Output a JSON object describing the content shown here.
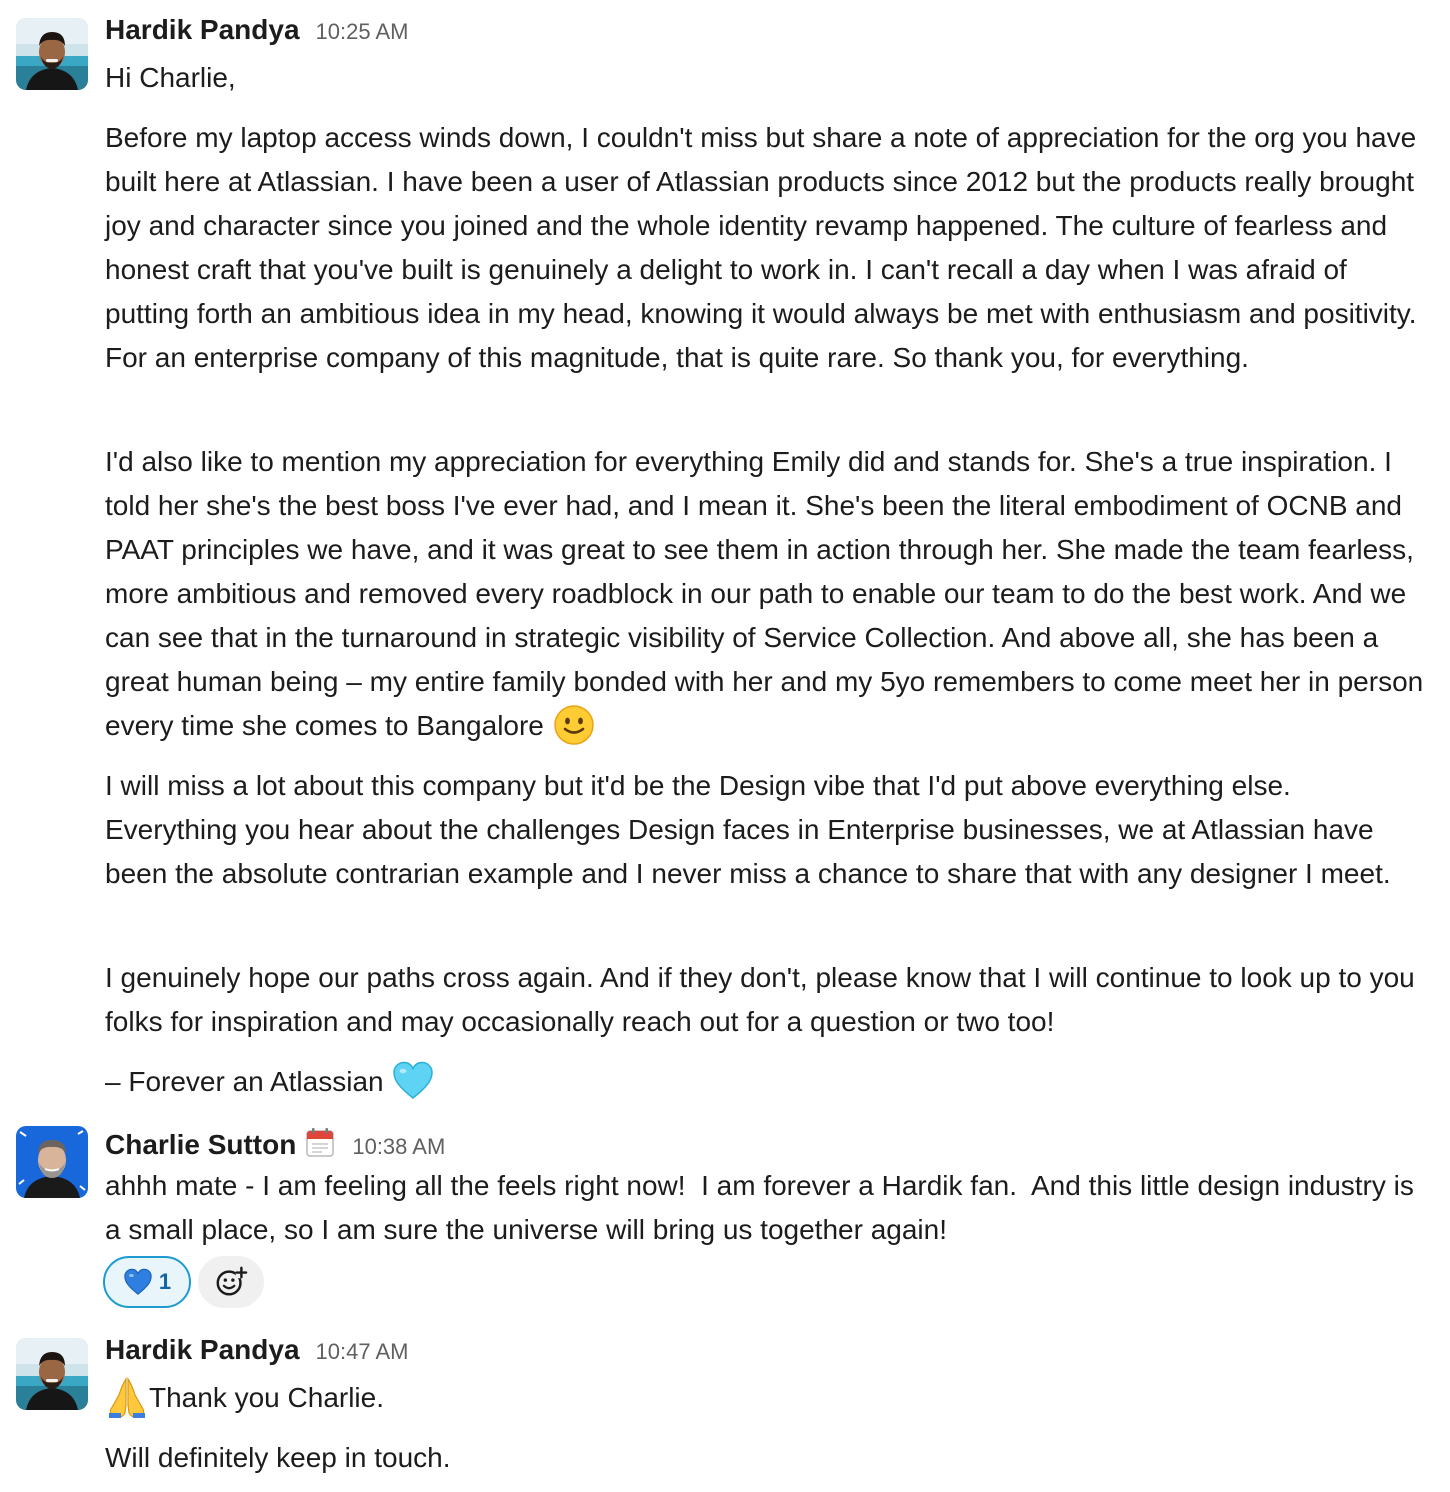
{
  "messages": [
    {
      "sender": "Hardik Pandya",
      "time": "10:25 AM",
      "paragraphs": [
        "Hi Charlie,",
        "Before my laptop access winds down, I couldn't miss but share a note of appreciation for the org you have built here at Atlassian. I have been a user of Atlassian products since 2012 but the products really brought joy and character since you joined and the whole identity revamp happened. The culture of fearless and honest craft that you've built is genuinely a delight to work in. I can't recall a day when I was afraid of putting forth an ambitious idea in my head, knowing it would always be met with enthusiasm and positivity. For an enterprise company of this magnitude, that is quite rare. So thank you, for everything.",
        "I'd also like to mention my appreciation for everything Emily did and stands for. She's a true inspiration. I told her she's the best boss I've ever had, and I mean it. She's been the literal embodiment of OCNB and PAAT principles we have, and it was great to see them in action through her. She made the team fearless, more ambitious and removed every roadblock in our path to enable our team to do the best work. And we can see that in the turnaround in strategic visibility of Service Collection. And above all, she has been a great human being – my entire family bonded with her and my 5yo remembers to come meet her in person every time she comes to Bangalore",
        "I will miss a lot about this company but it'd be the Design vibe that I'd put above everything else. Everything you hear about the challenges Design faces in Enterprise businesses, we at Atlassian have been the absolute contrarian example and I never miss a chance to share that with any designer I meet.",
        "I genuinely hope our paths cross again. And if they don't, please know that I will continue to look up to you folks for inspiration and may occasionally reach out for a question or two too!",
        "– Forever an Atlassian"
      ],
      "emojis": [
        "slightly-smiling-face",
        "light-blue-heart"
      ]
    },
    {
      "sender": "Charlie Sutton",
      "status_emoji": "calendar",
      "time": "10:38 AM",
      "paragraphs": [
        "ahhh mate - I am feeling all the feels right now!  I am forever a Hardik fan.  And this little design industry is a small place, so I am sure the universe will bring us together again!"
      ],
      "reactions": [
        {
          "emoji": "blue-heart",
          "count": "1",
          "active": true
        }
      ],
      "add_reaction_icon": "add-reaction-icon"
    },
    {
      "sender": "Hardik Pandya",
      "time": "10:47 AM",
      "paragraphs": [
        "Thank you Charlie.",
        "Will definitely keep in touch."
      ],
      "emojis": [
        "folded-hands"
      ]
    }
  ],
  "colors": {
    "text": "#1d1c1d",
    "timestamp": "#616061",
    "reaction_active_bg": "#e8f5fa",
    "reaction_active_border": "#1d9bd1",
    "reaction_count": "#1264a3",
    "add_reaction_bg": "#f0f0f0"
  }
}
